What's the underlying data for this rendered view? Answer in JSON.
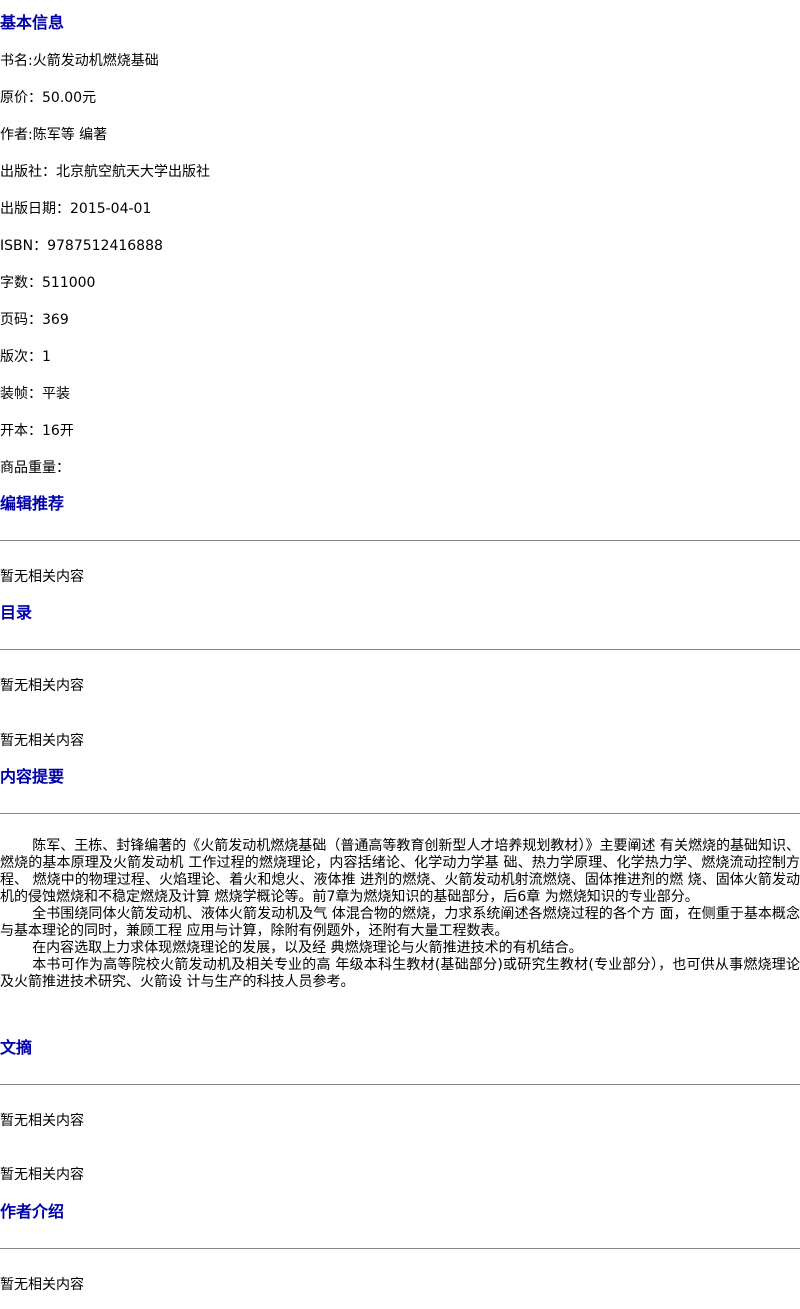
{
  "basic": {
    "heading": "基本信息",
    "fields": [
      "书名:火箭发动机燃烧基础",
      "原价：50.00元",
      "作者:陈军等 编著",
      "出版社：北京航空航天大学出版社",
      "出版日期：2015-04-01",
      "ISBN：9787512416888",
      "字数：511000",
      "页码：369",
      "版次：1",
      "装帧：平装",
      "开本：16开",
      "商品重量："
    ]
  },
  "editor": {
    "heading": "编辑推荐",
    "text": "暂无相关内容"
  },
  "toc": {
    "heading": "目录",
    "text1": "暂无相关内容",
    "text2": "暂无相关内容"
  },
  "summary": {
    "heading": "内容提要",
    "paragraphs": [
      "陈军、王栋、封锋编著的《火箭发动机燃烧基础（普通高等教育创新型人才培养规划教材）》主要阐述 有关燃烧的基础知识、燃烧的基本原理及火箭发动机 工作过程的燃烧理论，内容括绪论、化学动力学基 础、热力学原理、化学热力学、燃烧流动控制方程、 燃烧中的物理过程、火焰理论、着火和熄火、液体推 进剂的燃烧、火箭发动机射流燃烧、固体推进剂的燃 烧、固体火箭发动机的侵蚀燃烧和不稳定燃烧及计算 燃烧学概论等。前7章为燃烧知识的基础部分，后6章 为燃烧知识的专业部分。",
      "全书围绕同体火箭发动机、液体火箭发动机及气 体混合物的燃烧，力求系统阐述各燃烧过程的各个方 面，在侧重于基本概念与基本理论的同时，兼顾工程 应用与计算，除附有例题外，还附有大量工程数表。",
      "在内容选取上力求体现燃烧理论的发展，以及经 典燃烧理论与火箭推进技术的有机结合。",
      "本书可作为高等院校火箭发动机及相关专业的高 年级本科生教材(基础部分)或研究生教材(专业部分），也可供从事燃烧理论及火箭推进技术研究、火箭设 计与生产的科技人员参考。"
    ]
  },
  "excerpt": {
    "heading": "文摘",
    "text1": "暂无相关内容",
    "text2": "暂无相关内容"
  },
  "author": {
    "heading": "作者介绍",
    "text": "暂无相关内容"
  },
  "colors": {
    "heading": "#0000aa",
    "text": "#000000",
    "rule": "#888888",
    "background": "#ffffff"
  }
}
